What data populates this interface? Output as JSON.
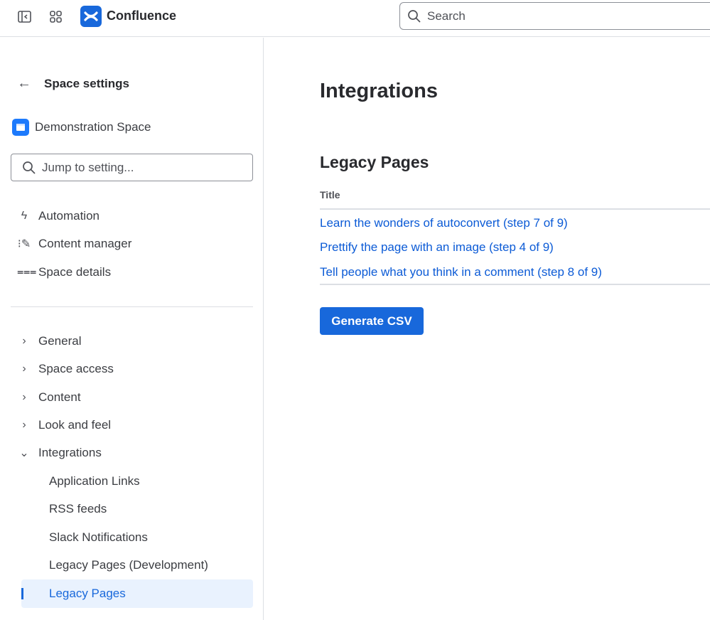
{
  "topbar": {
    "app_name": "Confluence",
    "search_placeholder": "Search"
  },
  "sidebar": {
    "back_label": "Space settings",
    "space_name": "Demonstration Space",
    "jump_placeholder": "Jump to setting...",
    "quick_items": [
      {
        "label": "Automation",
        "icon": "lightning-icon"
      },
      {
        "label": "Content manager",
        "icon": "content-manager-icon"
      },
      {
        "label": "Space details",
        "icon": "sliders-icon"
      }
    ],
    "groups": [
      {
        "label": "General"
      },
      {
        "label": "Space access"
      },
      {
        "label": "Content"
      },
      {
        "label": "Look and feel"
      },
      {
        "label": "Integrations"
      }
    ],
    "integration_items": [
      {
        "label": "Application Links"
      },
      {
        "label": "RSS feeds"
      },
      {
        "label": "Slack Notifications"
      },
      {
        "label": "Legacy Pages (Development)"
      },
      {
        "label": "Legacy Pages",
        "selected": true
      }
    ]
  },
  "main": {
    "title": "Integrations",
    "section_title": "Legacy Pages",
    "table_header": "Title",
    "rows": [
      "Learn the wonders of autoconvert (step 7 of 9)",
      "Prettify the page with an image (step 4 of 9)",
      "Tell people what you think in a comment (step 8 of 9)"
    ],
    "generate_button": "Generate CSV"
  },
  "colors": {
    "accent": "#1868db",
    "link": "#0c5bd6",
    "selected_bg": "#e9f2fe"
  }
}
